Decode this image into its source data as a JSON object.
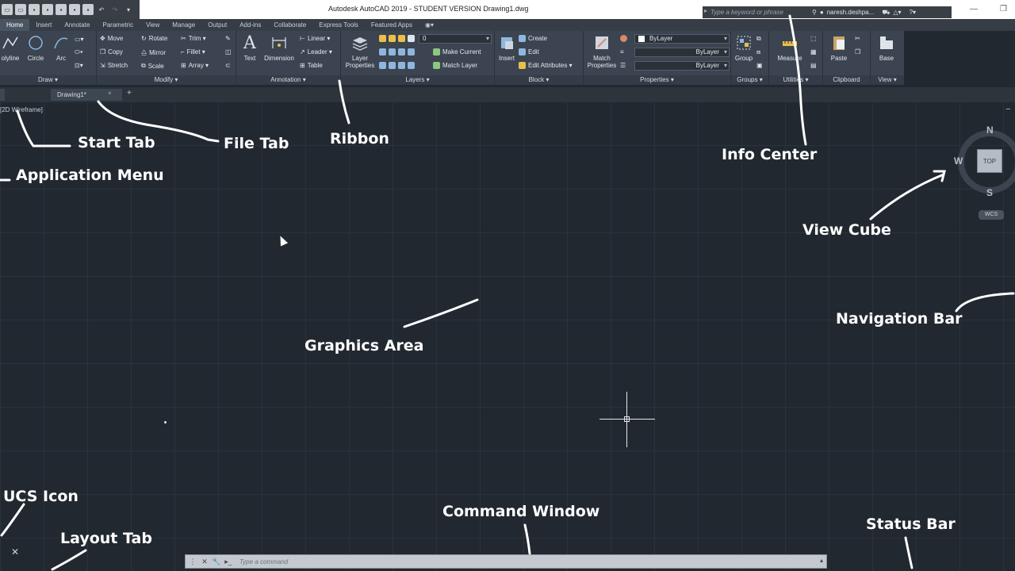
{
  "titlebar": {
    "title": "Autodesk AutoCAD 2019 - STUDENT VERSION   Drawing1.dwg",
    "search_placeholder": "Type a keyword or phrase",
    "user": "naresh.deshpa...",
    "minimize": "—",
    "restore": "❐"
  },
  "ribbon_tabs": [
    "Home",
    "Insert",
    "Annotate",
    "Parametric",
    "View",
    "Manage",
    "Output",
    "Add-ins",
    "Collaborate",
    "Express Tools",
    "Featured Apps"
  ],
  "ribbon": {
    "draw": {
      "title": "Draw ▾",
      "polyline": "olyline",
      "circle": "Circle",
      "arc": "Arc"
    },
    "modify": {
      "title": "Modify ▾",
      "move": "Move",
      "rotate": "Rotate",
      "trim": "Trim ▾",
      "copy": "Copy",
      "mirror": "Mirror",
      "fillet": "Fillet ▾",
      "stretch": "Stretch",
      "scale": "Scale",
      "array": "Array ▾"
    },
    "annotation": {
      "title": "Annotation ▾",
      "text": "Text",
      "dimension": "Dimension",
      "linear": "Linear ▾",
      "leader": "Leader ▾",
      "table": "Table"
    },
    "layers": {
      "title": "Layers ▾",
      "layer_properties_1": "Layer",
      "layer_properties_2": "Properties",
      "current_layer": "0",
      "make_current": "Make Current",
      "match_layer": "Match Layer"
    },
    "block": {
      "title": "Block ▾",
      "insert": "Insert",
      "create": "Create",
      "edit": "Edit",
      "edit_attributes": "Edit Attributes ▾"
    },
    "properties": {
      "title": "Properties ▾",
      "match_1": "Match",
      "match_2": "Properties",
      "color": "ByLayer",
      "linetype": "ByLayer",
      "lineweight": "ByLayer"
    },
    "groups": {
      "title": "Groups ▾",
      "group": "Group"
    },
    "utilities": {
      "title": "Utilities ▾",
      "measure": "Measure"
    },
    "clipboard": {
      "title": "Clipboard",
      "paste": "Paste"
    },
    "view": {
      "title": "View ▾",
      "base": "Base"
    }
  },
  "filetabs": {
    "drawing": "Drawing1*",
    "close": "×",
    "add": "+"
  },
  "viewport": {
    "label": "[2D Wireframe]",
    "minus": "–"
  },
  "viewcube": {
    "north": "N",
    "south": "S",
    "west": "W",
    "top": "TOP",
    "wcs": "WCS"
  },
  "command": {
    "close": "✕",
    "settings": "🔧",
    "prompt": "▸_",
    "placeholder": "Type a command",
    "expand": "▴"
  },
  "ucs": {
    "x": "✕"
  },
  "callouts": {
    "start_tab": "Start Tab",
    "file_tab": "File Tab",
    "ribbon": "Ribbon",
    "info_center": "Info Center",
    "application_menu": "Application Menu",
    "view_cube": "View Cube",
    "navigation_bar": "Navigation Bar",
    "graphics_area": "Graphics Area",
    "ucs_icon": "UCS Icon",
    "layout_tab": "Layout Tab",
    "command_window": "Command Window",
    "status_bar": "Status Bar"
  }
}
